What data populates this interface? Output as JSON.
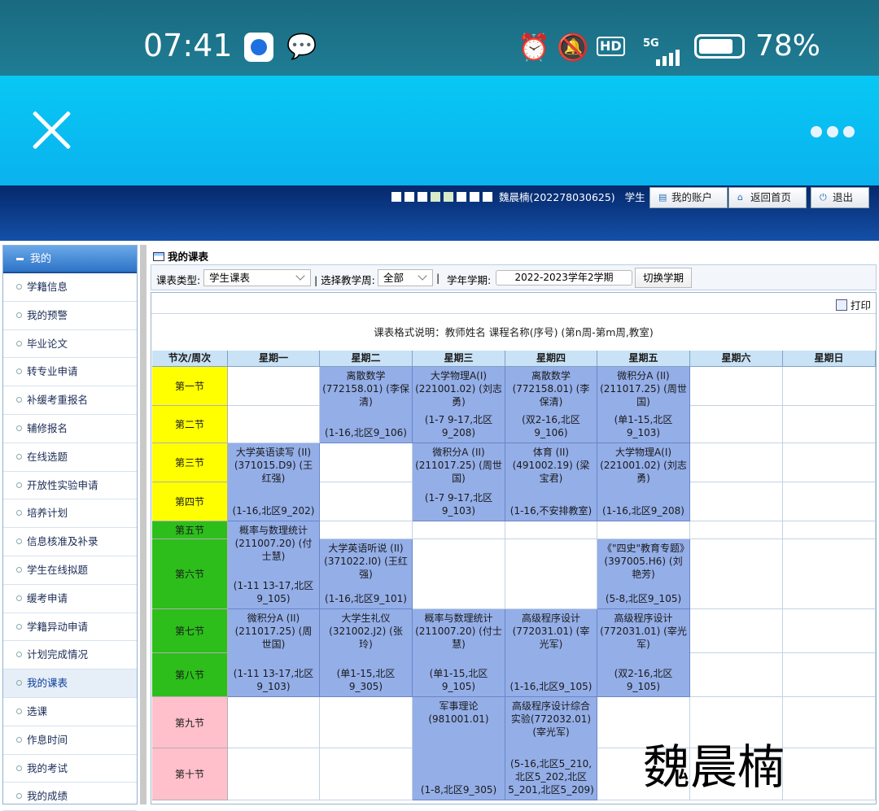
{
  "status_bar": {
    "time": "07:41",
    "battery_percent": "78%",
    "battery_level": 0.78,
    "network": "5G",
    "hd": "HD",
    "icons": [
      "qq-browser-icon",
      "wechat-icon",
      "alarm-icon",
      "mute-bell-icon",
      "hd-icon",
      "signal-icon",
      "battery-icon"
    ]
  },
  "webview_nav": {
    "close_icon": "close-icon",
    "more_icon": "more-dots-icon"
  },
  "header": {
    "user_text": "魏晨楠(202278030625)",
    "role": "学生",
    "buttons": {
      "account": "我的账户",
      "home": "返回首页",
      "logout": "退出"
    }
  },
  "sidebar": {
    "section": "我的",
    "items": [
      "学籍信息",
      "我的预警",
      "毕业论文",
      "转专业申请",
      "补缓考重报名",
      "辅修报名",
      "在线选题",
      "开放性实验申请",
      "培养计划",
      "信息核准及补录",
      "学生在线拟题",
      "缓考申请",
      "学籍异动申请",
      "计划完成情况",
      "我的课表",
      "选课",
      "作息时间",
      "我的考试",
      "我的成绩"
    ],
    "active": "我的课表"
  },
  "main": {
    "title": "我的课表",
    "toolbar": {
      "type_label": "课表类型:",
      "type_value": "学生课表",
      "week_label": "| 选择教学周:",
      "week_value": "全部",
      "sep": "|",
      "term_label": "学年学期:",
      "term_value": "2022-2023学年2学期",
      "switch_button": "切换学期"
    },
    "print": "打印",
    "format_note": "课表格式说明：教师姓名  课程名称(序号)  (第n周-第m周,教室)"
  },
  "timetable": {
    "headers": [
      "节次/周次",
      "星期一",
      "星期二",
      "星期三",
      "星期四",
      "星期五",
      "星期六",
      "星期日"
    ],
    "periods": [
      "第一节",
      "第二节",
      "第三节",
      "第四节",
      "第五节",
      "第六节",
      "第七节",
      "第八节",
      "第九节",
      "第十节"
    ],
    "courses": {
      "tue_12": {
        "name": "离散数学(772158.01) (李保清)",
        "loc": "(1-16,北区9_106)"
      },
      "wed_12": {
        "name": "大学物理A(I) (221001.02) (刘志勇)",
        "loc": "(1-7 9-17,北区9_208)"
      },
      "thu_12": {
        "name": "离散数学(772158.01) (李保清)",
        "loc": "(双2-16,北区9_106)"
      },
      "fri_12": {
        "name": "微积分A (II) (211017.25) (周世国)",
        "loc": "(单1-15,北区9_103)"
      },
      "mon_34": {
        "name": "大学英语读写 (II) (371015.D9) (王红强)",
        "loc": "(1-16,北区9_202)"
      },
      "wed_34": {
        "name": "微积分A (II) (211017.25) (周世国)",
        "loc": "(1-7 9-17,北区9_103)"
      },
      "thu_34": {
        "name": "体育 (II) (491002.19) (梁宝君)",
        "loc": "(1-16,不安排教室)"
      },
      "fri_34": {
        "name": "大学物理A(I) (221001.02) (刘志勇)",
        "loc": "(1-16,北区9_208)"
      },
      "mon_56": {
        "name": "概率与数理统计 (211007.20) (付士慧)",
        "loc": "(1-11 13-17,北区9_105)"
      },
      "tue_6": {
        "name": "大学英语听说 (II) (371022.I0) (王红强)",
        "loc": "(1-16,北区9_101)"
      },
      "fri_6": {
        "name": "《\"四史\"教育专题》(397005.H6) (刘艳芳)",
        "loc": "(5-8,北区9_105)"
      },
      "mon_78": {
        "name": "微积分A (II) (211017.25) (周世国)",
        "loc": "(1-11 13-17,北区9_103)"
      },
      "tue_78": {
        "name": "大学生礼仪 (321002.J2) (张玲)",
        "loc": "(单1-15,北区9_305)"
      },
      "wed_78": {
        "name": "概率与数理统计 (211007.20) (付士慧)",
        "loc": "(单1-15,北区9_105)"
      },
      "thu_78": {
        "name": "高级程序设计 (772031.01) (宰光军)",
        "loc": "(1-16,北区9_105)"
      },
      "fri_78": {
        "name": "高级程序设计 (772031.01) (宰光军)",
        "loc": "(双2-16,北区9_105)"
      },
      "wed_910": {
        "name": "军事理论 (981001.01)",
        "loc": "(1-8,北区9_305)"
      },
      "thu_910": {
        "name": "高级程序设计综合实验(772032.01) (宰光军)",
        "loc": "(5-16,北区5_210,北区5_202,北区5_201,北区5_209)"
      }
    },
    "colors": {
      "morning": "#ffff00",
      "afternoon": "#2dbe1c",
      "evening": "#ffc0cb",
      "course": "#94aee8",
      "header": "#c9e2f5"
    }
  },
  "watermark": "魏晨楠"
}
